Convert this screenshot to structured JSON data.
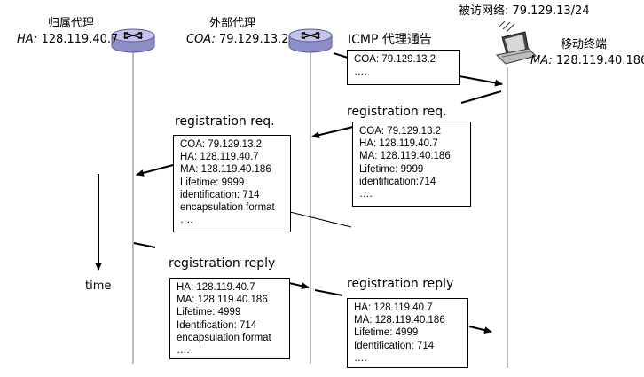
{
  "nodes": {
    "home_agent": {
      "title": "归属代理",
      "addr_prefix": "HA:",
      "addr": "128.119.40.7"
    },
    "foreign_agent": {
      "title": "外部代理",
      "addr_prefix": "COA:",
      "addr": "79.129.13.2"
    },
    "visited_network": {
      "label": "被访网络: 79.129.13/24"
    },
    "mobile_node": {
      "title": "移动终端",
      "addr_prefix": "MA:",
      "addr": "128.119.40.186"
    }
  },
  "messages": {
    "icmp_advert": {
      "title": "ICMP 代理通告",
      "lines": [
        "COA: 79.129.13.2",
        "…."
      ]
    },
    "reg_req_mobile": {
      "title": "registration req.",
      "lines": [
        "COA: 79.129.13.2",
        "HA: 128.119.40.7",
        "MA: 128.119.40.186",
        "Lifetime: 9999",
        "identification:714",
        "…."
      ]
    },
    "reg_req_foreign": {
      "title": "registration req.",
      "lines": [
        "COA: 79.129.13.2",
        "HA: 128.119.40.7",
        "MA: 128.119.40.186",
        "Lifetime: 9999",
        "identification: 714",
        "encapsulation format",
        "…."
      ]
    },
    "reg_reply_home": {
      "title": "registration reply",
      "lines": [
        "HA: 128.119.40.7",
        "MA: 128.119.40.186",
        "Lifetime: 4999",
        "Identification: 714",
        "encapsulation format",
        "…."
      ]
    },
    "reg_reply_foreign": {
      "title": "registration reply",
      "lines": [
        "HA: 128.119.40.7",
        "MA: 128.119.40.186",
        "Lifetime: 4999",
        "Identification: 714",
        "…."
      ]
    }
  },
  "time_label": "time",
  "colors": {
    "router_fill": "#b9b9e6",
    "router_stroke": "#5a5a9a",
    "line": "#000000",
    "lifeline": "#555555"
  }
}
